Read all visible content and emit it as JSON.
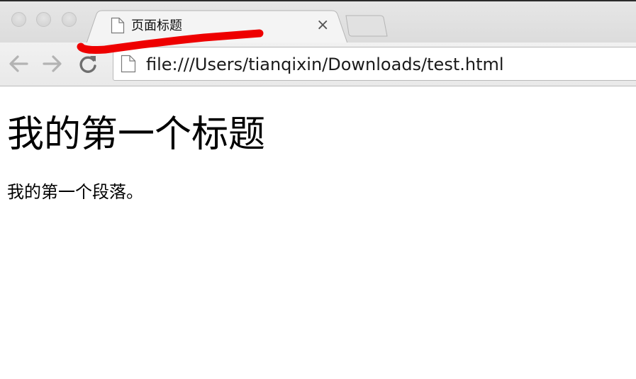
{
  "tab": {
    "title": "页面标题",
    "close_glyph": "×",
    "icon": "page-icon"
  },
  "toolbar": {
    "back_icon": "back-arrow-icon",
    "forward_icon": "forward-arrow-icon",
    "reload_icon": "reload-icon",
    "address": "file:///Users/tianqixin/Downloads/test.html",
    "address_icon": "page-icon"
  },
  "page": {
    "heading": "我的第一个标题",
    "paragraph": "我的第一个段落。"
  },
  "colors": {
    "annotation_stroke": "#ee0000",
    "chrome_bg": "#e6e6e6",
    "content_bg": "#ffffff"
  }
}
